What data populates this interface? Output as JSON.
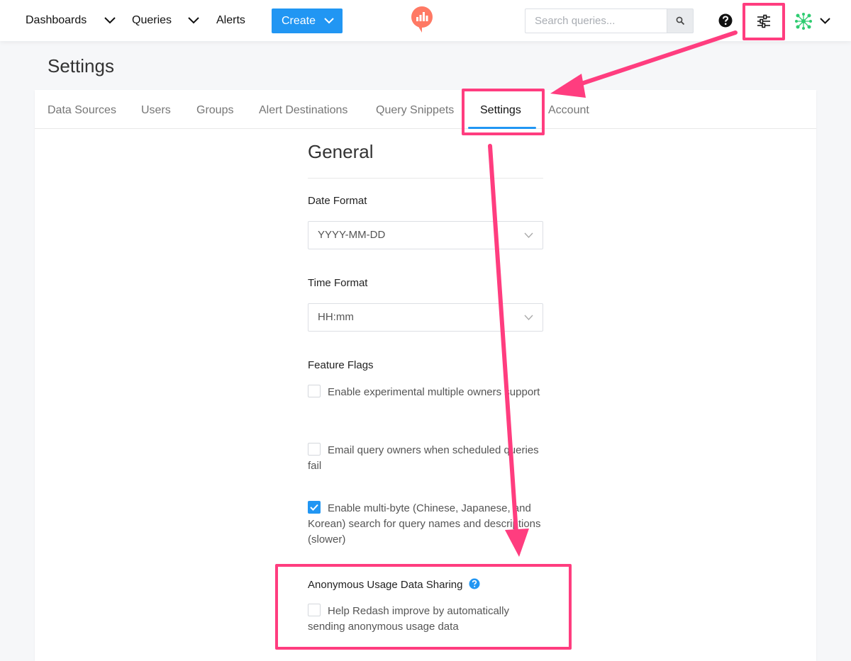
{
  "topnav": {
    "dashboards_label": "Dashboards",
    "queries_label": "Queries",
    "alerts_label": "Alerts",
    "create_label": "Create",
    "search_placeholder": "Search queries..."
  },
  "page": {
    "title": "Settings"
  },
  "tabs": [
    {
      "label": "Data Sources"
    },
    {
      "label": "Users"
    },
    {
      "label": "Groups"
    },
    {
      "label": "Alert Destinations"
    },
    {
      "label": "Query Snippets"
    },
    {
      "label": "Settings",
      "active": true
    },
    {
      "label": "Account"
    }
  ],
  "general": {
    "heading": "General",
    "date_format": {
      "label": "Date Format",
      "value": "YYYY-MM-DD"
    },
    "time_format": {
      "label": "Time Format",
      "value": "HH:mm"
    },
    "feature_flags": {
      "label": "Feature Flags",
      "options": [
        {
          "text": "Enable experimental multiple owners support",
          "checked": false
        },
        {
          "text": "Email query owners when scheduled queries fail",
          "checked": false
        },
        {
          "text": "Enable multi-byte (Chinese, Japanese, and Korean) search for query names and descriptions (slower)",
          "checked": true
        }
      ]
    },
    "usage_sharing": {
      "label": "Anonymous Usage Data Sharing",
      "option": {
        "text": "Help Redash improve by automatically sending anonymous usage data",
        "checked": false
      }
    }
  },
  "colors": {
    "accent": "#2196f3",
    "annotation": "#ff3d7f",
    "logo": "#ff7964"
  },
  "icons": [
    "chevron-down-icon",
    "redash-logo-icon",
    "search-icon",
    "help-icon",
    "settings-sliders-icon",
    "avatar-icon",
    "info-icon",
    "checkmark-icon"
  ]
}
